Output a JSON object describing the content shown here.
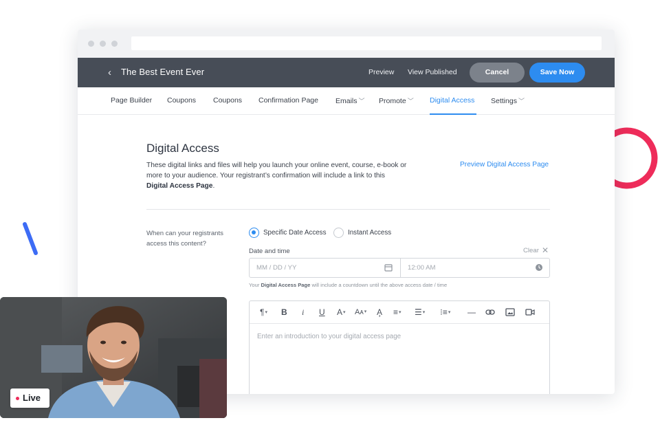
{
  "colors": {
    "accent": "#2d8cf0",
    "appbar": "#474d57",
    "decor_ring": "#ee2c5a",
    "decor_line": "#3d6cf5",
    "live_dot": "#ee2c5a"
  },
  "header": {
    "back_icon": "chevron-left-icon",
    "title": "The Best Event Ever",
    "preview": "Preview",
    "view_published": "View Published",
    "cancel": "Cancel",
    "save": "Save Now"
  },
  "tabs": [
    {
      "label": "Page Builder"
    },
    {
      "label": "Coupons"
    },
    {
      "label": "Coupons"
    },
    {
      "label": "Confirmation Page"
    },
    {
      "label": "Emails"
    },
    {
      "label": "Promote"
    },
    {
      "label": "Digital Access",
      "active": true
    },
    {
      "label": "Settings"
    }
  ],
  "page": {
    "title": "Digital Access",
    "desc_line1": "These digital links and files will help you launch your online event, course, e-book or",
    "desc_line2": "more to your audience. Your registrant’s confirmation will include a link to this",
    "desc_bold": "Digital Access Page",
    "desc_end": ".",
    "preview_link": "Preview Digital Access Page"
  },
  "access": {
    "question": "When can your registrants access this content?",
    "option_specific": "Specific Date Access",
    "option_instant": "Instant Access",
    "selected": "Specific Date Access",
    "date_time_label": "Date and time",
    "clear": "Clear",
    "date_placeholder": "MM / DD / YY",
    "time_placeholder": "12:00 AM",
    "hint_prefix": "Your",
    "hint_bold": "Digital Access Page",
    "hint_rest": "will include a countdown until the above access date / time"
  },
  "editor": {
    "toolbar": [
      "paragraph-icon",
      "bold-icon",
      "italic-icon",
      "underline-icon",
      "font-color-icon",
      "font-size-icon",
      "highlight-icon",
      "align-icon",
      "bullet-list-icon",
      "numbered-list-icon",
      "horizontal-rule-icon",
      "link-icon",
      "image-icon",
      "video-icon"
    ],
    "placeholder": "Enter an introduction to your digital access page"
  },
  "video": {
    "live_label": "Live"
  }
}
